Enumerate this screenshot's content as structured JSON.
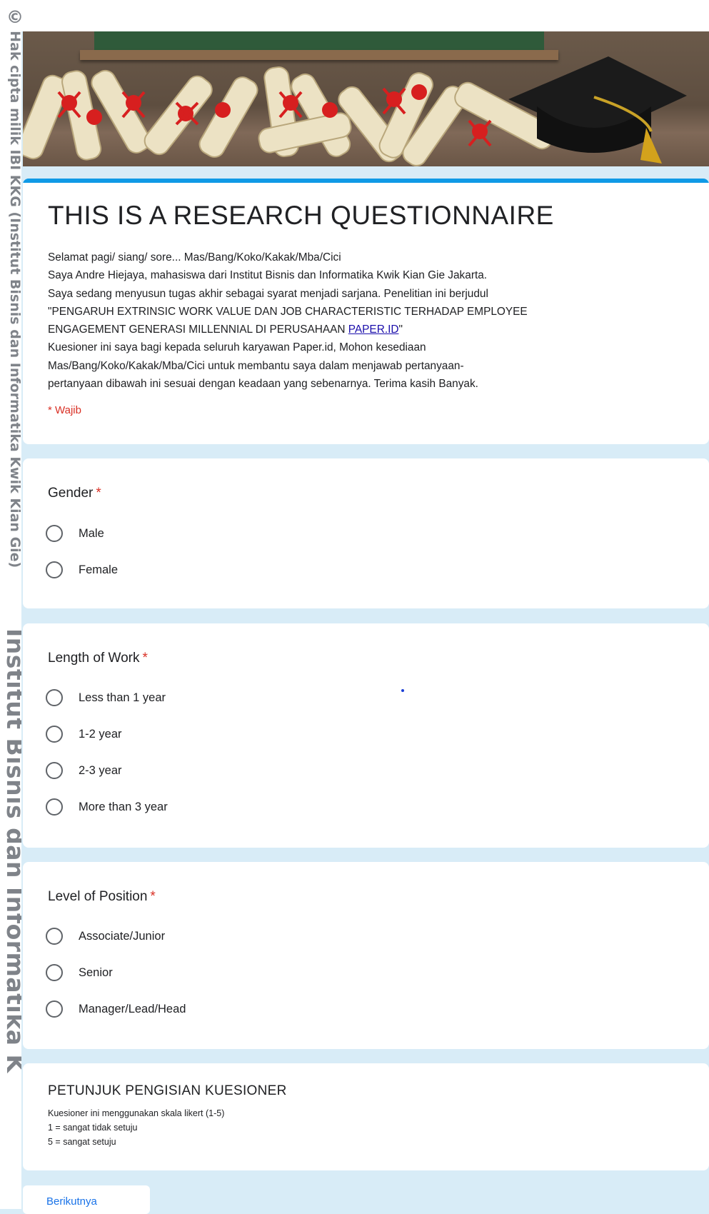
{
  "watermark": {
    "symbol": "©",
    "small_text": "Hak cipta milik IBI KKG (Institut Bisnis dan Informatika Kwik Kian Gie)",
    "big_text": "Institut Bisnis dan Informatika K"
  },
  "form": {
    "title": "THIS IS A RESEARCH QUESTIONNAIRE",
    "description_lines": [
      "Selamat pagi/ siang/ sore... Mas/Bang/Koko/Kakak/Mba/Cici",
      "Saya Andre Hiejaya, mahasiswa dari Institut Bisnis dan Informatika Kwik Kian Gie Jakarta.",
      "Saya sedang menyusun tugas akhir sebagai syarat menjadi sarjana. Penelitian ini berjudul",
      "\"PENGARUH EXTRINSIC WORK VALUE DAN JOB CHARACTERISTIC TERHADAP EMPLOYEE",
      "ENGAGEMENT GENERASI MILLENNIAL DI PERUSAHAAN ",
      "Kuesioner ini saya bagi kepada seluruh karyawan Paper.id, Mohon kesediaan",
      "Mas/Bang/Koko/Kakak/Mba/Cici untuk membantu saya dalam menjawab pertanyaan-",
      "pertanyaan dibawah ini sesuai dengan keadaan yang sebenarnya. Terima kasih Banyak."
    ],
    "link_text": "PAPER.ID",
    "link_suffix": "\"",
    "required_note": "* Wajib"
  },
  "questions": [
    {
      "title": "Gender",
      "required_mark": "*",
      "options": [
        "Male",
        "Female"
      ]
    },
    {
      "title": "Length of Work",
      "required_mark": "*",
      "options": [
        "Less than 1 year",
        "1-2 year",
        "2-3 year",
        "More than 3 year"
      ]
    },
    {
      "title": "Level of Position",
      "required_mark": "*",
      "options": [
        "Associate/Junior",
        "Senior",
        "Manager/Lead/Head"
      ]
    }
  ],
  "instructions": {
    "title": "PETUNJUK PENGISIAN KUESIONER",
    "lines": [
      "Kuesioner ini menggunakan skala likert (1-5)",
      "1 = sangat tidak setuju",
      "5 = sangat setuju"
    ]
  },
  "next_button": {
    "label": "Berikutnya"
  },
  "colors": {
    "accent": "#0f9ae6",
    "background": "#d8ecf7",
    "required": "#d93025",
    "link": "#1a0dab"
  }
}
